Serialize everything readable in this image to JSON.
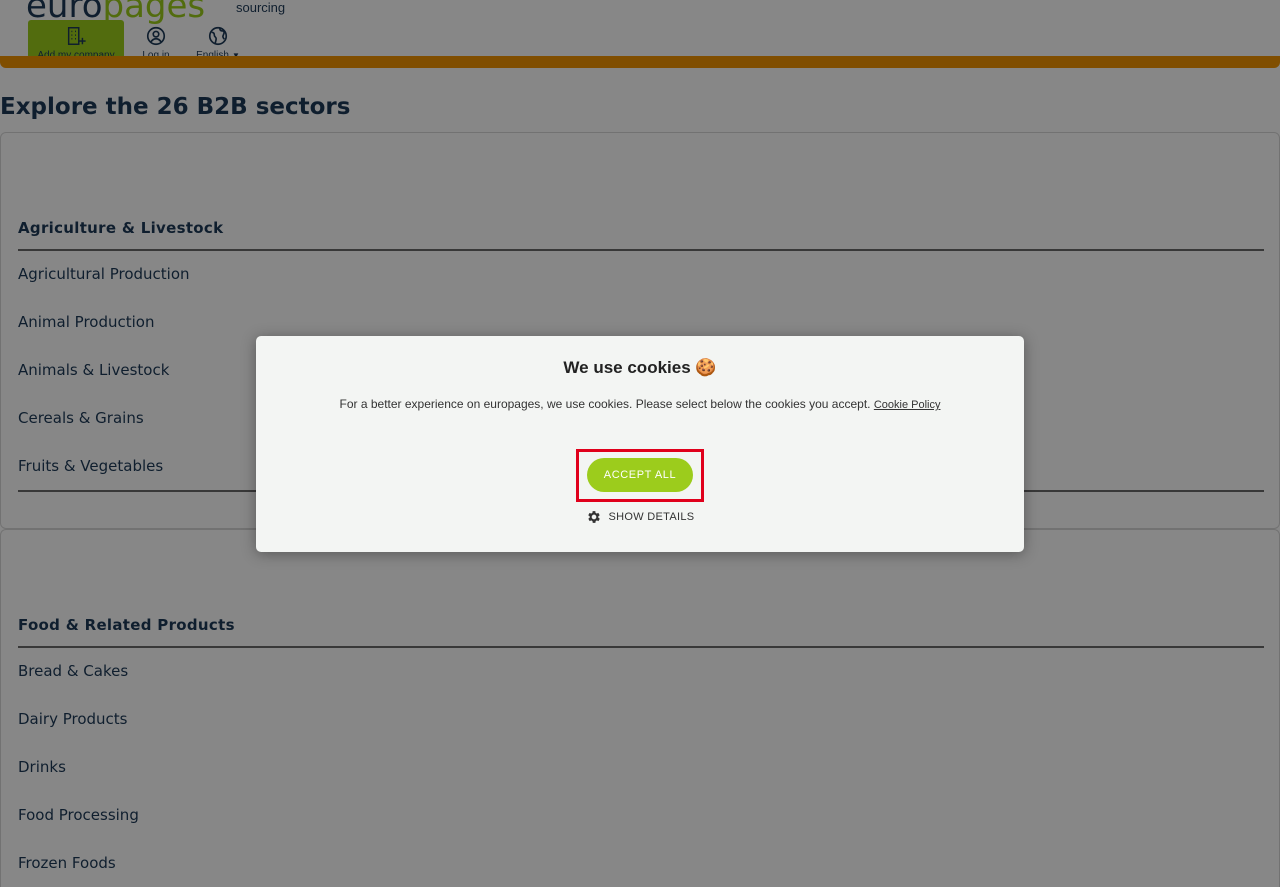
{
  "header": {
    "logo_euro": "euro",
    "logo_pages": "pages",
    "logo_sub": "sourcing",
    "add_company": "Add my company",
    "login": "Log in",
    "language": "English"
  },
  "main": {
    "title": "Explore the 26 B2B sectors",
    "sectors": [
      {
        "name": "Agriculture & Livestock",
        "items": [
          "Agricultural Production",
          "Animal Production",
          "Animals & Livestock",
          "Cereals & Grains",
          "Fruits & Vegetables"
        ]
      },
      {
        "name": "Food & Related Products",
        "items": [
          "Bread & Cakes",
          "Dairy Products",
          "Drinks",
          "Food Processing",
          "Frozen Foods"
        ]
      }
    ]
  },
  "cookie_modal": {
    "title": "We use cookies 🍪",
    "text": "For a better experience on europages, we use cookies. Please select below the cookies you accept.",
    "policy_link": "Cookie Policy",
    "accept_label": "ACCEPT ALL",
    "details_label": "SHOW DETAILS"
  },
  "colors": {
    "brand_green": "#9ccc1c",
    "brand_orange": "#f29400",
    "brand_navy": "#1d3a57",
    "highlight_red": "#e0001b"
  },
  "icons": [
    "building-add-icon",
    "user-circle-icon",
    "globe-icon",
    "gear-icon"
  ]
}
